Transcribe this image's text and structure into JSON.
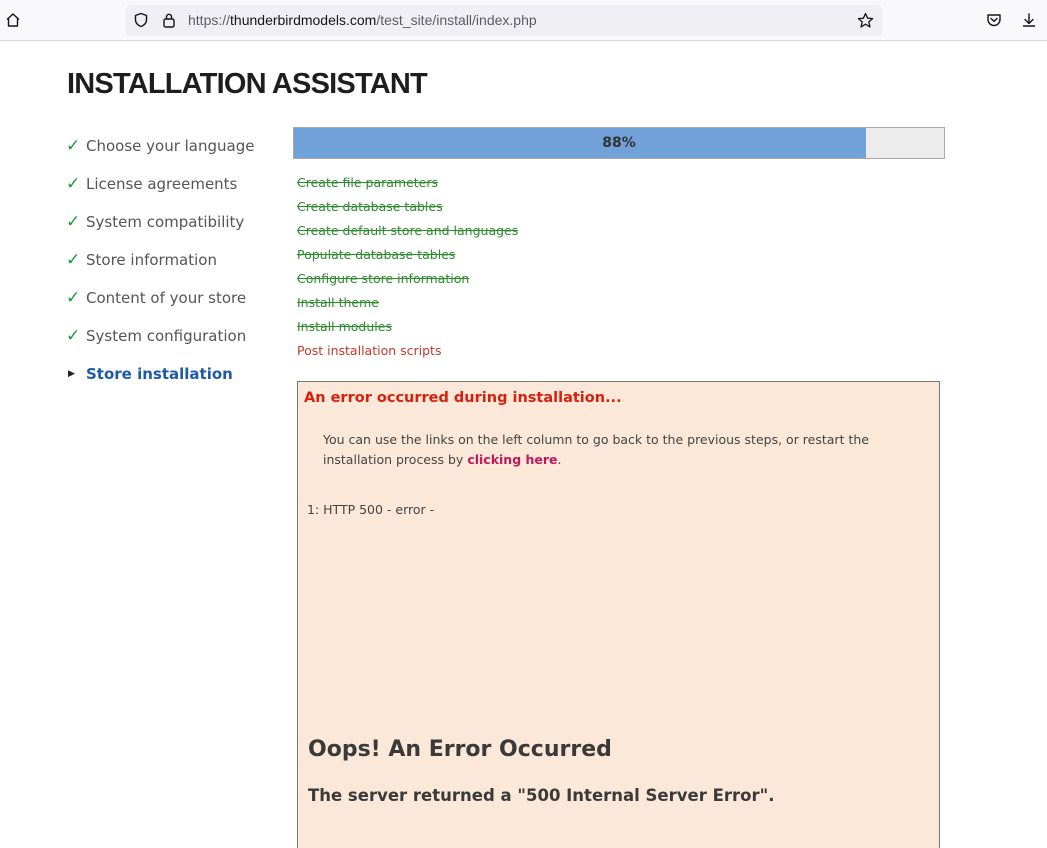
{
  "browser": {
    "url_prefix": "https://",
    "url_host": "thunderbirdmodels.com",
    "url_path": "/test_site/install/index.php",
    "icons": [
      "home-icon",
      "shield-icon",
      "lock-icon",
      "star-icon",
      "pocket-icon",
      "download-icon"
    ]
  },
  "page": {
    "title": "INSTALLATION ASSISTANT"
  },
  "steps": [
    {
      "label": "Choose your language",
      "status": "done"
    },
    {
      "label": "License agreements",
      "status": "done"
    },
    {
      "label": "System compatibility",
      "status": "done"
    },
    {
      "label": "Store information",
      "status": "done"
    },
    {
      "label": "Content of your store",
      "status": "done"
    },
    {
      "label": "System configuration",
      "status": "done"
    },
    {
      "label": "Store installation",
      "status": "current"
    }
  ],
  "progress": {
    "percent_label": "88%",
    "value": 0.88,
    "fill_color": "#70a1d9"
  },
  "tasks": [
    {
      "label": "Create file parameters",
      "status": "done"
    },
    {
      "label": "Create database tables",
      "status": "done"
    },
    {
      "label": "Create default store and languages",
      "status": "done"
    },
    {
      "label": "Populate database tables",
      "status": "done"
    },
    {
      "label": "Configure store information",
      "status": "done"
    },
    {
      "label": "Install theme",
      "status": "done"
    },
    {
      "label": "Install modules",
      "status": "done"
    },
    {
      "label": "Post installation scripts",
      "status": "pending"
    }
  ],
  "error": {
    "title": "An error occurred during installation...",
    "message_before": "You can use the links on the left column to go back to the previous steps, or restart the installation process by ",
    "link_text": "clicking here",
    "message_after": ".",
    "item": "1: HTTP 500 - error -",
    "heading": "Oops! An Error Occurred",
    "subheading": "The server returned a \"500 Internal Server Error\"."
  },
  "colors": {
    "check": "#1b9a3a",
    "current_step": "#1e5aa8",
    "error_title": "#d9200e",
    "error_bg": "#fbe8d8",
    "link": "#c2185b"
  }
}
